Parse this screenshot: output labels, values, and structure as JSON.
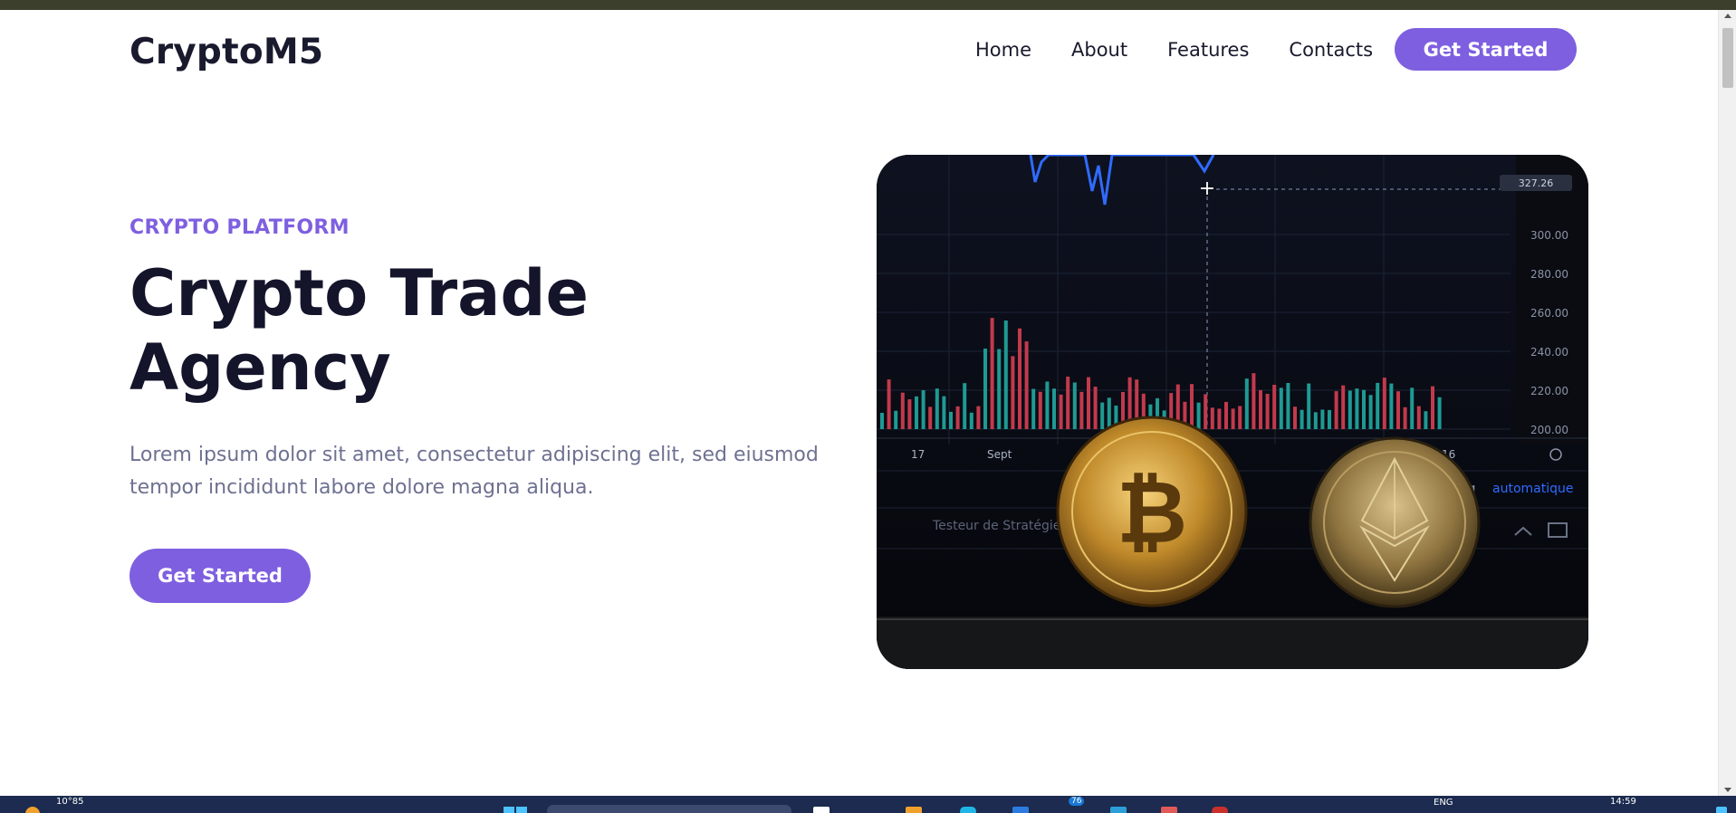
{
  "brand": {
    "logo": "CryptoM5"
  },
  "nav": {
    "links": [
      "Home",
      "About",
      "Features",
      "Contacts"
    ],
    "cta_label": "Get Started"
  },
  "hero": {
    "eyebrow": "CRYPTO PLATFORM",
    "title_line1": "Crypto Trade",
    "title_line2": "Agency",
    "text_line1": "Lorem ipsum dolor sit amet, consectetur adipiscing elit, sed eiusmod",
    "text_line2": "tempor incididunt labore dolore magna aliqua.",
    "cta_label": "Get Started"
  },
  "hero_image": {
    "price_ticks": [
      "300.00",
      "280.00",
      "260.00",
      "240.00",
      "220.00",
      "200.00"
    ],
    "price_marker": "327.26",
    "date_labels": [
      "17",
      "Sept",
      "16"
    ],
    "scale_options": [
      "%",
      "log",
      "automatique"
    ],
    "panel_label": "Testeur de Stratégie"
  },
  "taskbar": {
    "weather": "10°85",
    "badge": "76",
    "lang": "ENG",
    "time": "14:59"
  },
  "colors": {
    "accent": "#7e5fe0",
    "heading": "#14142b",
    "body_text": "#6e7191",
    "top_strip": "#3b3f2b"
  }
}
